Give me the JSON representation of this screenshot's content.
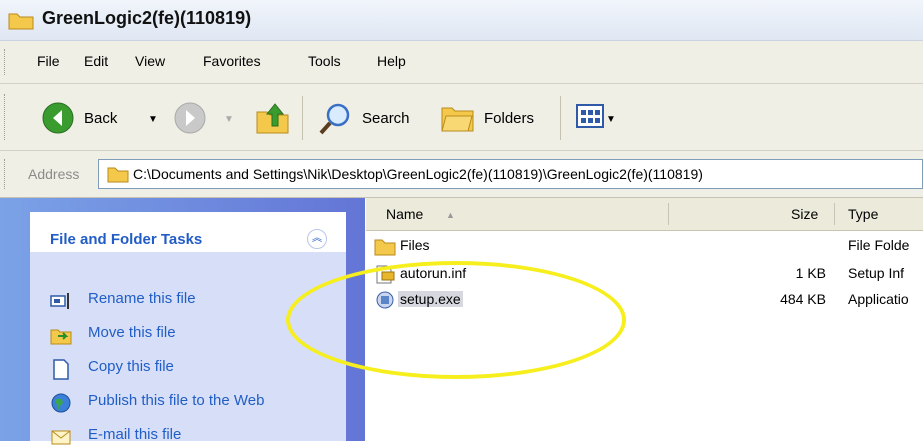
{
  "window": {
    "title": "GreenLogic2(fe)(110819)"
  },
  "menubar": {
    "items": [
      {
        "label": "File"
      },
      {
        "label": "Edit"
      },
      {
        "label": "View"
      },
      {
        "label": "Favorites"
      },
      {
        "label": "Tools"
      },
      {
        "label": "Help"
      }
    ]
  },
  "toolbar": {
    "back_label": "Back",
    "search_label": "Search",
    "folders_label": "Folders"
  },
  "address": {
    "label": "Address",
    "path": "C:\\Documents and Settings\\Nik\\Desktop\\GreenLogic2(fe)(110819)\\GreenLogic2(fe)(110819)"
  },
  "tasks": {
    "title": "File and Folder Tasks",
    "items": [
      {
        "label": "Rename this file",
        "icon": "rename-icon"
      },
      {
        "label": "Move this file",
        "icon": "move-icon"
      },
      {
        "label": "Copy this file",
        "icon": "copy-icon"
      },
      {
        "label": "Publish this file to the Web",
        "icon": "globe-icon"
      },
      {
        "label": "E-mail this file",
        "icon": "email-icon"
      }
    ]
  },
  "filelist": {
    "columns": {
      "name": "Name",
      "size": "Size",
      "type": "Type"
    },
    "rows": [
      {
        "name": "Files",
        "size": "",
        "type": "File Folde",
        "icon": "folder-icon"
      },
      {
        "name": "autorun.inf",
        "size": "1 KB",
        "type": "Setup Inf",
        "icon": "setup-info-icon"
      },
      {
        "name": "setup.exe",
        "size": "484 KB",
        "type": "Applicatio",
        "icon": "application-icon",
        "selected": true
      }
    ]
  },
  "colors": {
    "highlight": "#f7ee1e",
    "task_link": "#215dc6",
    "pane_gradient": [
      "#7ba2e7",
      "#6375d6"
    ]
  }
}
